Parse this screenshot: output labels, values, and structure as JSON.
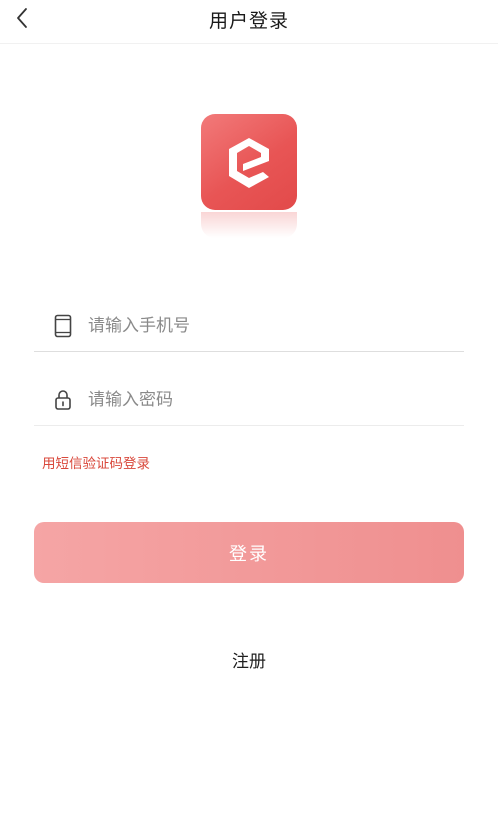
{
  "header": {
    "title": "用户登录",
    "back_icon": "chevron-left-icon"
  },
  "logo": {
    "icon": "app-logo-e-icon",
    "brand_color": "#e85555"
  },
  "form": {
    "phone": {
      "icon": "mobile-phone-icon",
      "placeholder": "请输入手机号",
      "value": ""
    },
    "password": {
      "icon": "lock-icon",
      "placeholder": "请输入密码",
      "value": ""
    },
    "sms_login_label": "用短信验证码登录",
    "login_label": "登录",
    "register_label": "注册"
  },
  "colors": {
    "accent_text": "#d9483b",
    "button_start": "#f5a5a5",
    "button_end": "#ef8f8f"
  }
}
